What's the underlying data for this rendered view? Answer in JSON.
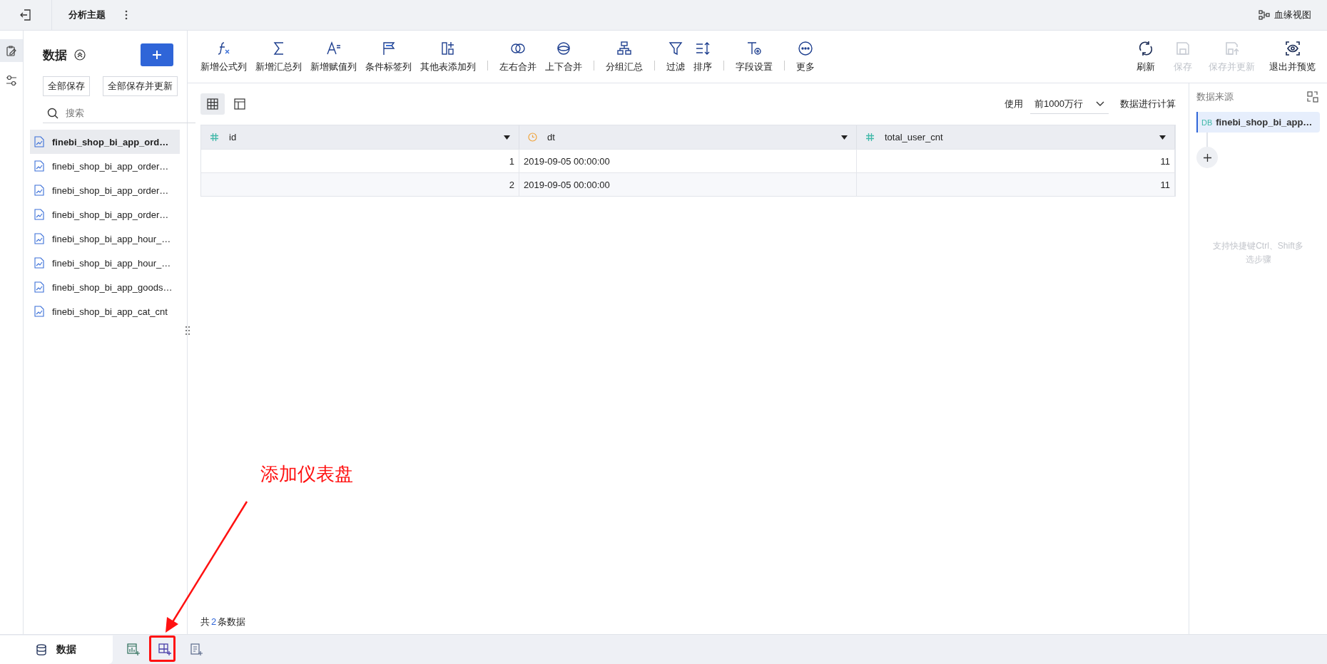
{
  "top_bar": {
    "title": "分析主题",
    "right_link": "血缘视图"
  },
  "side_rail": [
    {
      "selected": true
    },
    {
      "selected": false
    }
  ],
  "data_panel": {
    "title": "数据",
    "buttons": [
      "全部保存",
      "全部保存并更新"
    ],
    "search": {
      "placeholder": "搜索"
    },
    "tables": [
      {
        "name": "finebi_shop_bi_app_ord…",
        "selected": true
      },
      {
        "name": "finebi_shop_bi_app_order…",
        "selected": false
      },
      {
        "name": "finebi_shop_bi_app_order…",
        "selected": false
      },
      {
        "name": "finebi_shop_bi_app_order…",
        "selected": false
      },
      {
        "name": "finebi_shop_bi_app_hour_…",
        "selected": false
      },
      {
        "name": "finebi_shop_bi_app_hour_…",
        "selected": false
      },
      {
        "name": "finebi_shop_bi_app_goods…",
        "selected": false
      },
      {
        "name": "finebi_shop_bi_app_cat_cnt",
        "selected": false
      }
    ]
  },
  "toolbar": {
    "groups": [
      [
        {
          "label": "新增公式列"
        },
        {
          "label": "新增汇总列"
        },
        {
          "label": "新增赋值列"
        },
        {
          "label": "条件标签列"
        },
        {
          "label": "其他表添加列"
        }
      ],
      [
        {
          "label": "左右合并"
        },
        {
          "label": "上下合并"
        }
      ],
      [
        {
          "label": "分组汇总"
        }
      ],
      [
        {
          "label": "过滤"
        },
        {
          "label": "排序"
        }
      ],
      [
        {
          "label": "字段设置"
        }
      ],
      [
        {
          "label": "更多"
        }
      ]
    ],
    "actions": [
      {
        "label": "刷新",
        "disabled": false
      },
      {
        "label": "保存",
        "disabled": true
      },
      {
        "label": "保存并更新",
        "disabled": true
      },
      {
        "label": "退出并预览",
        "disabled": false
      }
    ]
  },
  "view_switch": [
    {
      "selected": true
    },
    {
      "selected": false
    }
  ],
  "row_limit": {
    "prefix": "使用",
    "value": "前1000万行",
    "suffix": "数据进行计算"
  },
  "table": {
    "columns": [
      {
        "name": "id",
        "kind": "number"
      },
      {
        "name": "dt",
        "kind": "date"
      },
      {
        "name": "total_user_cnt",
        "kind": "number"
      }
    ],
    "rows": [
      [
        "1",
        "2019-09-05 00:00:00",
        "11"
      ],
      [
        "2",
        "2019-09-05 00:00:00",
        "11"
      ]
    ]
  },
  "row_count": {
    "prefix": "共",
    "count": "2",
    "suffix": "条数据"
  },
  "source_panel": {
    "title": "数据来源",
    "source": {
      "badge": "DB",
      "name": "finebi_shop_bi_app…"
    },
    "hint": "支持快捷键Ctrl、Shift多选步骤"
  },
  "bottom_tabs": [
    {
      "kind": "data",
      "label": "数据",
      "selected": true
    },
    {
      "kind": "add-chart",
      "selected": false
    },
    {
      "kind": "add-dashboard",
      "selected": false
    },
    {
      "kind": "add-report",
      "selected": false
    }
  ],
  "annotation": {
    "text": "添加仪表盘"
  }
}
